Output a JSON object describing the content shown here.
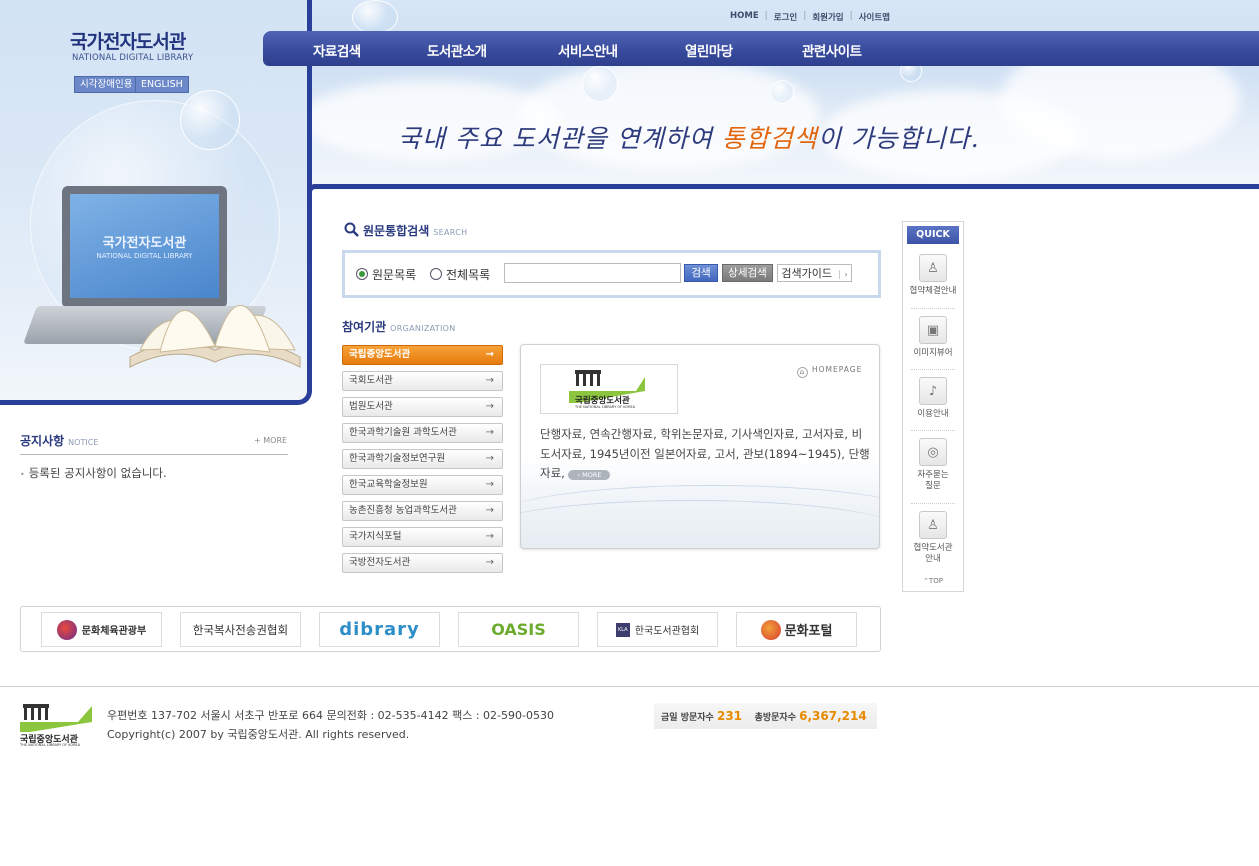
{
  "header": {
    "logo_title": "국가전자도서관",
    "logo_sub": "NATIONAL DIGITAL LIBRARY",
    "btn_accessibility": "시각장애인용",
    "btn_english": "ENGLISH",
    "top_links": [
      "HOME",
      "로그인",
      "회원가입",
      "사이트맵"
    ],
    "nav": [
      "자료검색",
      "도서관소개",
      "서비스안내",
      "열린마당",
      "관련사이트"
    ],
    "slogan_a": "국내 주요 도서관을 연계하여 ",
    "slogan_highlight": "통합검색",
    "slogan_b": "이 가능합니다.",
    "laptop_title": "국가전자도서관",
    "laptop_sub": "NATIONAL DIGITAL LIBRARY"
  },
  "search": {
    "title": "원문통합검색",
    "title_eng": "SEARCH",
    "radio_1": "원문목록",
    "radio_2": "전체목록",
    "input_value": "",
    "btn_search": "검색",
    "btn_detail": "상세검색",
    "btn_guide": "검색가이드"
  },
  "org": {
    "title": "참여기관",
    "title_eng": "ORGANIZATION",
    "items": [
      "국립중앙도서관",
      "국회도서관",
      "법원도서관",
      "한국과학기술원 과학도서관",
      "한국과학기술정보연구원",
      "한국교육학술정보원",
      "농촌진흥청 농업과학도서관",
      "국가지식포털",
      "국방전자도서관"
    ],
    "homepage": "HOMEPAGE",
    "logo_text": "국립중앙도서관",
    "logo_sub": "THE NATIONAL LIBRARY OF KOREA",
    "description": "단행자료, 연속간행자료, 학위논문자료, 기사색인자료, 고서자료, 비도서자료, 1945년이전 일본어자료, 고서, 관보(1894~1945), 단행자료,",
    "more": "MORE"
  },
  "quick": {
    "title": "QUICK",
    "items": [
      "협약체결안내",
      "이미지뷰어",
      "이용안내",
      "자주묻는 질문",
      "협약도서관 안내"
    ],
    "top": "TOP"
  },
  "notice": {
    "title": "공지사항",
    "title_eng": "NOTICE",
    "more": "+ MORE",
    "text": "등록된 공지사항이 없습니다."
  },
  "banners": [
    "문화체육관광부",
    "한국복사전송권협회",
    "dibrary",
    "OASIS",
    "한국도서관협회",
    "문화포털"
  ],
  "footer": {
    "logo_text": "국립중앙도서관",
    "logo_sub": "THE NATIONAL LIBRARY OF KOREA",
    "address": "우편번호 137-702 서울시 서초구 반포로 664 문의전화 : 02-535-4142 팩스 : 02-590-0530",
    "copyright": "Copyright(c) 2007 by 국립중앙도서관. All rights reserved.",
    "today_label": "금일 방문자수",
    "today_value": "231",
    "total_label": "총방문자수",
    "total_value": "6,367,214"
  },
  "colors": {
    "brand_navy": "#2a3f99",
    "accent_orange": "#e77a0c",
    "nlk_green": "#8cc63f"
  }
}
